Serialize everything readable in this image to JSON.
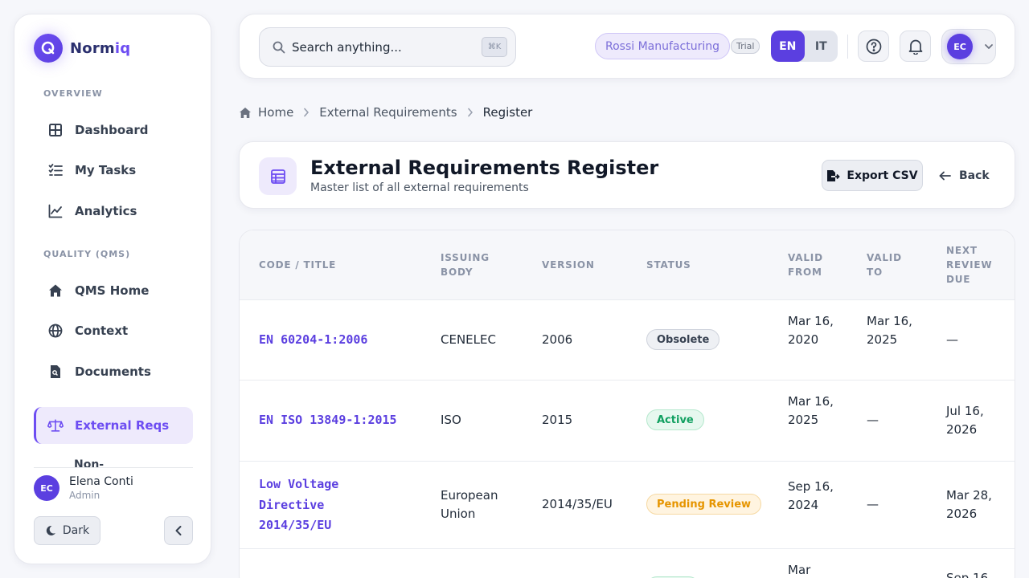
{
  "brand": {
    "name_prefix": "Norm",
    "name_suffix": "iq",
    "logo_letter": "Q"
  },
  "sidebar": {
    "section_overview": "OVERVIEW",
    "section_quality": "QUALITY (QMS)",
    "items": [
      {
        "label": "Dashboard",
        "icon": "grid-icon"
      },
      {
        "label": "My Tasks",
        "icon": "checklist-icon"
      },
      {
        "label": "Analytics",
        "icon": "chart-line-icon"
      },
      {
        "label": "QMS Home",
        "icon": "home-icon"
      },
      {
        "label": "Context",
        "icon": "globe-icon"
      },
      {
        "label": "Documents",
        "icon": "document-icon"
      },
      {
        "label": "External Reqs",
        "icon": "scale-icon",
        "active": true
      },
      {
        "label": "Non-",
        "icon": ""
      }
    ],
    "user": {
      "initials": "EC",
      "name": "Elena Conti",
      "role": "Admin"
    },
    "dark_label": "Dark"
  },
  "topbar": {
    "search_placeholder": "Search anything...",
    "shortcut": "⌘K",
    "org": "Rossi Manufacturing",
    "plan": "Trial",
    "lang_en": "EN",
    "lang_it": "IT",
    "user_initials": "EC"
  },
  "breadcrumb": {
    "home": "Home",
    "parent": "External Requirements",
    "current": "Register"
  },
  "header": {
    "title": "External Requirements Register",
    "subtitle": "Master list of all external requirements",
    "export_label": "Export CSV",
    "back_label": "Back"
  },
  "table": {
    "columns": [
      "CODE / TITLE",
      "ISSUING BODY",
      "VERSION",
      "STATUS",
      "VALID FROM",
      "VALID TO",
      "NEXT REVIEW DUE"
    ],
    "rows": [
      {
        "code": "EN 60204-1:2006",
        "body": "CENELEC",
        "version": "2006",
        "status": "Obsolete",
        "valid_from": "Mar 16, 2020",
        "valid_to": "Mar 16, 2025",
        "next_review": "—"
      },
      {
        "code": "EN ISO 13849-1:2015",
        "body": "ISO",
        "version": "2015",
        "status": "Active",
        "valid_from": "Mar 16, 2025",
        "valid_to": "—",
        "next_review": "Jul 16, 2026"
      },
      {
        "code": "Low Voltage Directive 2014/35/EU",
        "body": "European Union",
        "version": "2014/35/EU",
        "status": "Pending Review",
        "valid_from": "Sep 16, 2024",
        "valid_to": "—",
        "next_review": "Mar 28, 2026"
      },
      {
        "code": "",
        "body": "",
        "version": "",
        "status": "",
        "valid_from": "Mar",
        "valid_to": "",
        "next_review": "Sep 16"
      }
    ]
  },
  "colors": {
    "accent": "#5b3fe0",
    "active": "#10a060",
    "pending": "#e69500"
  }
}
